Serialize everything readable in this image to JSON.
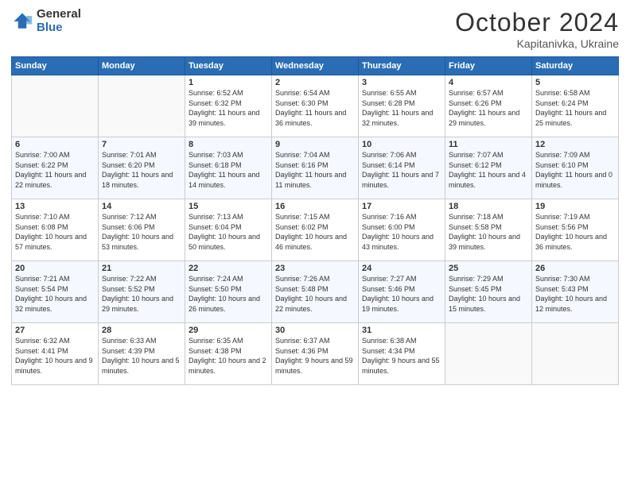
{
  "logo": {
    "general": "General",
    "blue": "Blue"
  },
  "header": {
    "month": "October 2024",
    "location": "Kapitanivka, Ukraine"
  },
  "weekdays": [
    "Sunday",
    "Monday",
    "Tuesday",
    "Wednesday",
    "Thursday",
    "Friday",
    "Saturday"
  ],
  "weeks": [
    [
      {
        "day": "",
        "info": ""
      },
      {
        "day": "",
        "info": ""
      },
      {
        "day": "1",
        "info": "Sunrise: 6:52 AM\nSunset: 6:32 PM\nDaylight: 11 hours and 39 minutes."
      },
      {
        "day": "2",
        "info": "Sunrise: 6:54 AM\nSunset: 6:30 PM\nDaylight: 11 hours and 36 minutes."
      },
      {
        "day": "3",
        "info": "Sunrise: 6:55 AM\nSunset: 6:28 PM\nDaylight: 11 hours and 32 minutes."
      },
      {
        "day": "4",
        "info": "Sunrise: 6:57 AM\nSunset: 6:26 PM\nDaylight: 11 hours and 29 minutes."
      },
      {
        "day": "5",
        "info": "Sunrise: 6:58 AM\nSunset: 6:24 PM\nDaylight: 11 hours and 25 minutes."
      }
    ],
    [
      {
        "day": "6",
        "info": "Sunrise: 7:00 AM\nSunset: 6:22 PM\nDaylight: 11 hours and 22 minutes."
      },
      {
        "day": "7",
        "info": "Sunrise: 7:01 AM\nSunset: 6:20 PM\nDaylight: 11 hours and 18 minutes."
      },
      {
        "day": "8",
        "info": "Sunrise: 7:03 AM\nSunset: 6:18 PM\nDaylight: 11 hours and 14 minutes."
      },
      {
        "day": "9",
        "info": "Sunrise: 7:04 AM\nSunset: 6:16 PM\nDaylight: 11 hours and 11 minutes."
      },
      {
        "day": "10",
        "info": "Sunrise: 7:06 AM\nSunset: 6:14 PM\nDaylight: 11 hours and 7 minutes."
      },
      {
        "day": "11",
        "info": "Sunrise: 7:07 AM\nSunset: 6:12 PM\nDaylight: 11 hours and 4 minutes."
      },
      {
        "day": "12",
        "info": "Sunrise: 7:09 AM\nSunset: 6:10 PM\nDaylight: 11 hours and 0 minutes."
      }
    ],
    [
      {
        "day": "13",
        "info": "Sunrise: 7:10 AM\nSunset: 6:08 PM\nDaylight: 10 hours and 57 minutes."
      },
      {
        "day": "14",
        "info": "Sunrise: 7:12 AM\nSunset: 6:06 PM\nDaylight: 10 hours and 53 minutes."
      },
      {
        "day": "15",
        "info": "Sunrise: 7:13 AM\nSunset: 6:04 PM\nDaylight: 10 hours and 50 minutes."
      },
      {
        "day": "16",
        "info": "Sunrise: 7:15 AM\nSunset: 6:02 PM\nDaylight: 10 hours and 46 minutes."
      },
      {
        "day": "17",
        "info": "Sunrise: 7:16 AM\nSunset: 6:00 PM\nDaylight: 10 hours and 43 minutes."
      },
      {
        "day": "18",
        "info": "Sunrise: 7:18 AM\nSunset: 5:58 PM\nDaylight: 10 hours and 39 minutes."
      },
      {
        "day": "19",
        "info": "Sunrise: 7:19 AM\nSunset: 5:56 PM\nDaylight: 10 hours and 36 minutes."
      }
    ],
    [
      {
        "day": "20",
        "info": "Sunrise: 7:21 AM\nSunset: 5:54 PM\nDaylight: 10 hours and 32 minutes."
      },
      {
        "day": "21",
        "info": "Sunrise: 7:22 AM\nSunset: 5:52 PM\nDaylight: 10 hours and 29 minutes."
      },
      {
        "day": "22",
        "info": "Sunrise: 7:24 AM\nSunset: 5:50 PM\nDaylight: 10 hours and 26 minutes."
      },
      {
        "day": "23",
        "info": "Sunrise: 7:26 AM\nSunset: 5:48 PM\nDaylight: 10 hours and 22 minutes."
      },
      {
        "day": "24",
        "info": "Sunrise: 7:27 AM\nSunset: 5:46 PM\nDaylight: 10 hours and 19 minutes."
      },
      {
        "day": "25",
        "info": "Sunrise: 7:29 AM\nSunset: 5:45 PM\nDaylight: 10 hours and 15 minutes."
      },
      {
        "day": "26",
        "info": "Sunrise: 7:30 AM\nSunset: 5:43 PM\nDaylight: 10 hours and 12 minutes."
      }
    ],
    [
      {
        "day": "27",
        "info": "Sunrise: 6:32 AM\nSunset: 4:41 PM\nDaylight: 10 hours and 9 minutes."
      },
      {
        "day": "28",
        "info": "Sunrise: 6:33 AM\nSunset: 4:39 PM\nDaylight: 10 hours and 5 minutes."
      },
      {
        "day": "29",
        "info": "Sunrise: 6:35 AM\nSunset: 4:38 PM\nDaylight: 10 hours and 2 minutes."
      },
      {
        "day": "30",
        "info": "Sunrise: 6:37 AM\nSunset: 4:36 PM\nDaylight: 9 hours and 59 minutes."
      },
      {
        "day": "31",
        "info": "Sunrise: 6:38 AM\nSunset: 4:34 PM\nDaylight: 9 hours and 55 minutes."
      },
      {
        "day": "",
        "info": ""
      },
      {
        "day": "",
        "info": ""
      }
    ]
  ]
}
